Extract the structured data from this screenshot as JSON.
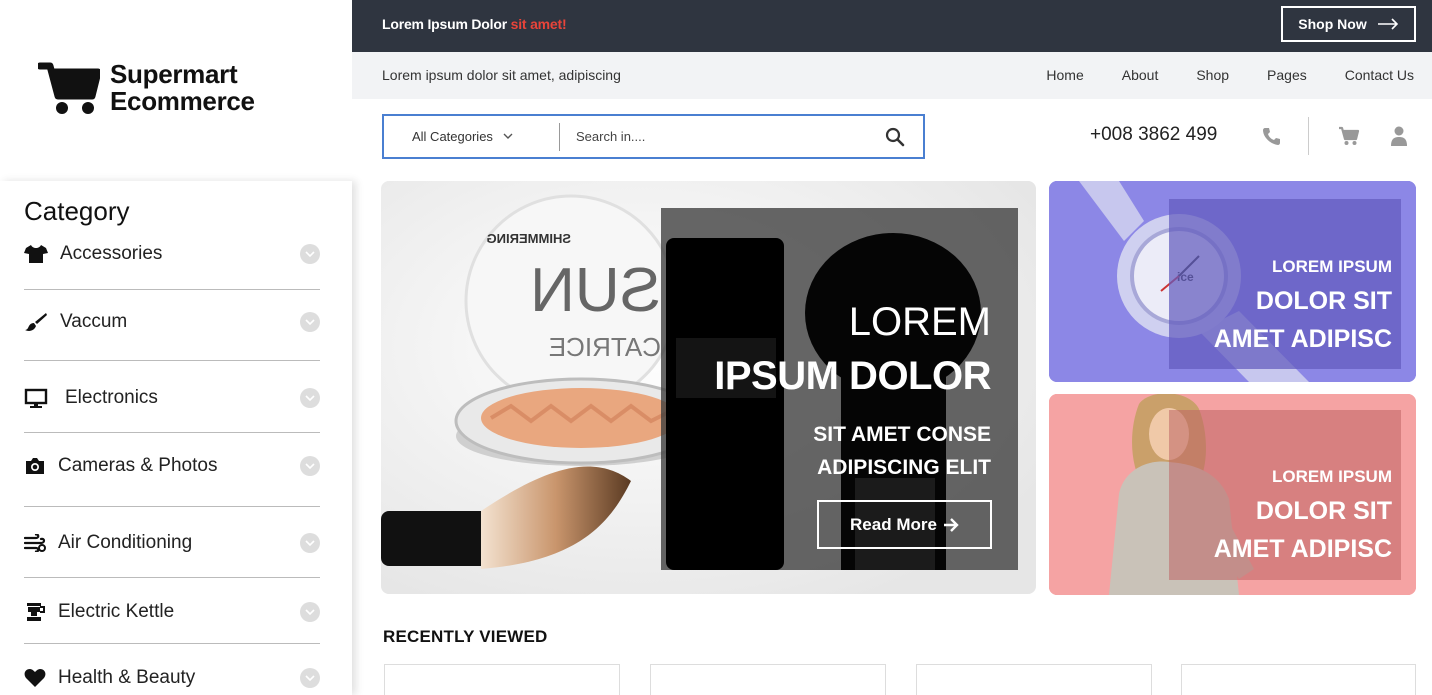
{
  "topbar": {
    "promo_main": "Lorem Ipsum Dolor ",
    "promo_highlight": "sit amet!",
    "shop_now": "Shop Now",
    "highlight_color": "#e8443a",
    "bg_color": "#2f3540"
  },
  "navbar": {
    "tagline": "Lorem ipsum dolor sit amet, adipiscing",
    "links": [
      "Home",
      "About",
      "Shop",
      "Pages",
      "Contact Us"
    ]
  },
  "logo": {
    "line1": "Supermart",
    "line2": "Ecommerce",
    "icon": "cart-icon"
  },
  "search": {
    "category_label": "All Categories",
    "placeholder": "Search in....",
    "border_color": "#4a7fd1"
  },
  "contact": {
    "phone": "+008 3862 499"
  },
  "sidebar": {
    "title": "Category",
    "items": [
      {
        "label": "Accessories",
        "icon": "tshirt-icon"
      },
      {
        "label": "Vaccum",
        "icon": "brush-icon"
      },
      {
        "label": "Electronics",
        "icon": "monitor-icon"
      },
      {
        "label": "Cameras & Photos",
        "icon": "camera-icon"
      },
      {
        "label": "Air Conditioning",
        "icon": "fan-icon"
      },
      {
        "label": "Electric Kettle",
        "icon": "kettle-icon"
      },
      {
        "label": "Health & Beauty",
        "icon": "heart-icon"
      }
    ]
  },
  "hero": {
    "line1": "LOREM",
    "line2": "IPSUM DOLOR",
    "line3": "SIT AMET CONSE",
    "line4": "ADIPISCING ELIT",
    "button": "Read More",
    "product_text_top": "SHIMMERING",
    "product_text_main": "SUN",
    "product_text_brand": "CATRICE"
  },
  "banners": [
    {
      "line1": "LOREM IPSUM",
      "line2": "DOLOR SIT",
      "line3": "AMET ADIPISC",
      "bg_color": "#7b76e0",
      "watch_label": "ice"
    },
    {
      "line1": "LOREM IPSUM",
      "line2": "DOLOR SIT",
      "line3": "AMET ADIPISC",
      "bg_color": "#f4a0a0"
    }
  ],
  "recently_viewed": {
    "title": "RECENTLY VIEWED"
  }
}
